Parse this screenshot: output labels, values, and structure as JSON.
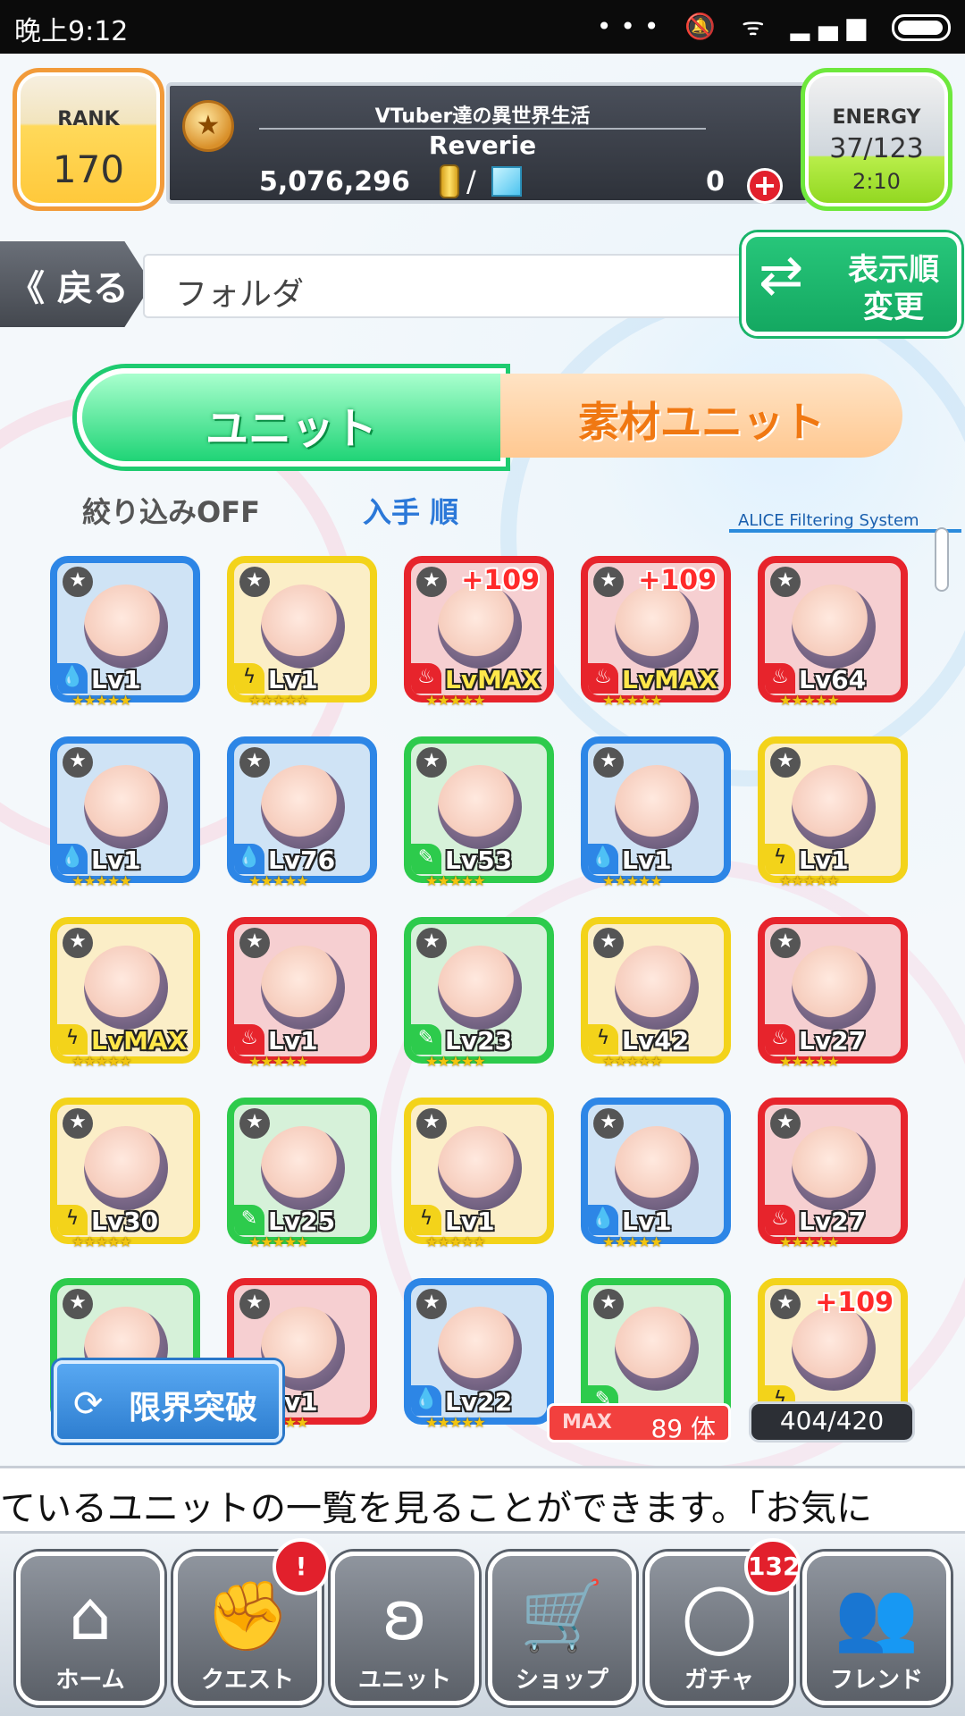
{
  "status_bar": {
    "time": "晚上9:12",
    "icons_text": "••• 🔕 ᯤ ▂▄▆"
  },
  "header": {
    "rank_label": "RANK",
    "rank": "170",
    "title": "VTuber達の異世界生活",
    "player_name": "Reverie",
    "gold": "5,076,296",
    "slash": "/",
    "gems": "0",
    "plus": "+",
    "energy_label": "ENERGY",
    "energy": "37/123",
    "energy_timer": "2:10"
  },
  "nav_row": {
    "back_label": "《 戻る",
    "folder_label": "フォルダ",
    "sort_label": "表示順 変更"
  },
  "tabs": {
    "unit": "ユニット",
    "material": "素材ユニット"
  },
  "filter": {
    "filter_off": "絞り込みOFF",
    "order": "入手 順",
    "system": "ALICE Filtering System"
  },
  "cards": [
    {
      "frame": "blue",
      "element": "water",
      "level": "Lv1",
      "plus": "",
      "stars": "★★★★★"
    },
    {
      "frame": "yellow",
      "element": "thunder",
      "level": "Lv1",
      "plus": "",
      "stars": "★★★★★"
    },
    {
      "frame": "red",
      "element": "fire",
      "level": "LvMAX",
      "plus": "+109",
      "stars": "★★★★★"
    },
    {
      "frame": "red",
      "element": "fire",
      "level": "LvMAX",
      "plus": "+109",
      "stars": "★★★★★"
    },
    {
      "frame": "red",
      "element": "fire",
      "level": "Lv64",
      "plus": "",
      "stars": "★★★★★"
    },
    {
      "frame": "blue",
      "element": "water",
      "level": "Lv1",
      "plus": "",
      "stars": "★★★★★"
    },
    {
      "frame": "blue",
      "element": "water",
      "level": "Lv76",
      "plus": "",
      "stars": "★★★★★"
    },
    {
      "frame": "green",
      "element": "wind",
      "level": "Lv53",
      "plus": "",
      "stars": "★★★★★"
    },
    {
      "frame": "blue",
      "element": "water",
      "level": "Lv1",
      "plus": "",
      "stars": "★★★★★"
    },
    {
      "frame": "yellow",
      "element": "thunder",
      "level": "Lv1",
      "plus": "",
      "stars": "★★★★★"
    },
    {
      "frame": "yellow",
      "element": "thunder",
      "level": "LvMAX",
      "plus": "",
      "stars": "★★★★★"
    },
    {
      "frame": "red",
      "element": "fire",
      "level": "Lv1",
      "plus": "",
      "stars": "★★★★★"
    },
    {
      "frame": "green",
      "element": "wind",
      "level": "Lv23",
      "plus": "",
      "stars": "★★★★★"
    },
    {
      "frame": "yellow",
      "element": "thunder",
      "level": "Lv42",
      "plus": "",
      "stars": "★★★★★"
    },
    {
      "frame": "red",
      "element": "fire",
      "level": "Lv27",
      "plus": "",
      "stars": "★★★★★"
    },
    {
      "frame": "yellow",
      "element": "thunder",
      "level": "Lv30",
      "plus": "",
      "stars": "★★★★★"
    },
    {
      "frame": "green",
      "element": "wind",
      "level": "Lv25",
      "plus": "",
      "stars": "★★★★★"
    },
    {
      "frame": "yellow",
      "element": "thunder",
      "level": "Lv1",
      "plus": "",
      "stars": "★★★★★"
    },
    {
      "frame": "blue",
      "element": "water",
      "level": "Lv1",
      "plus": "",
      "stars": "★★★★★"
    },
    {
      "frame": "red",
      "element": "fire",
      "level": "Lv27",
      "plus": "",
      "stars": "★★★★★"
    },
    {
      "frame": "green",
      "element": "wind",
      "level": "",
      "plus": "",
      "stars": "★★★★★"
    },
    {
      "frame": "red",
      "element": "fire",
      "level": "Lv1",
      "plus": "",
      "stars": "★★★★★"
    },
    {
      "frame": "blue",
      "element": "water",
      "level": "Lv22",
      "plus": "",
      "stars": "★★★★★"
    },
    {
      "frame": "green",
      "element": "wind",
      "level": "",
      "plus": "",
      "stars": "★★★★★"
    },
    {
      "frame": "yellow",
      "element": "thunder",
      "level": "",
      "plus": "+109",
      "stars": "★★★★★"
    }
  ],
  "overlay": {
    "limit_break": "限界突破",
    "max_tag": "MAX",
    "max_count": "89 体",
    "unit_count": "404/420"
  },
  "ticker": "ているユニットの一覧を見ることができます。「お気に",
  "bottom_nav": [
    {
      "label": "ホーム",
      "icon": "home-icon",
      "badge": ""
    },
    {
      "label": "クエスト",
      "icon": "handshake-icon",
      "badge": "!"
    },
    {
      "label": "ユニット",
      "icon": "bunny-icon",
      "badge": ""
    },
    {
      "label": "ショップ",
      "icon": "cart-icon",
      "badge": ""
    },
    {
      "label": "ガチャ",
      "icon": "egg-icon",
      "badge": "132"
    },
    {
      "label": "フレンド",
      "icon": "friends-icon",
      "badge": ""
    }
  ],
  "colors": {
    "water": "#2d86e6",
    "thunder": "#f3d31a",
    "fire": "#e7242c",
    "wind": "#2dcb4c",
    "accent_green": "#1ecb70",
    "accent_orange": "#f07812"
  }
}
